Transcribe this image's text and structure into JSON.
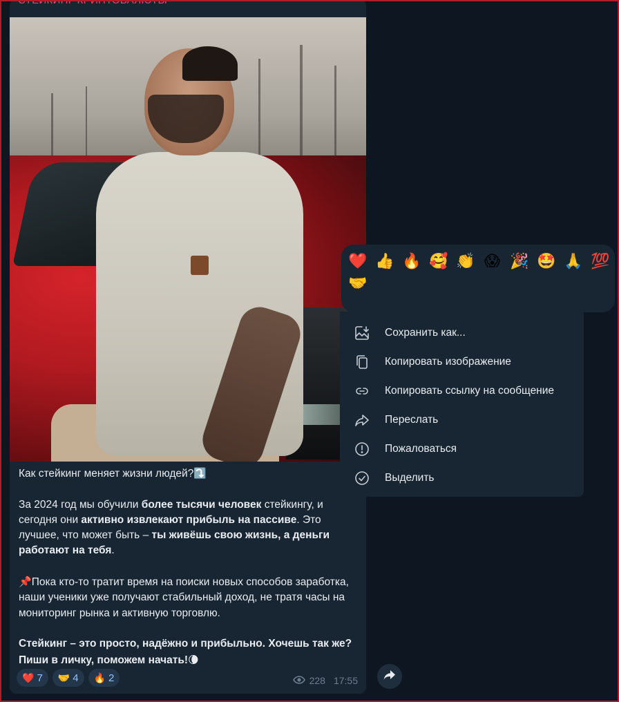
{
  "channel": {
    "name": "СТЕЙКИНГ КРИПТОВАЛЮТЫ"
  },
  "message": {
    "photo_alt": "photo",
    "title_line": "Как стейкинг меняет жизни людей?",
    "title_emoji": "⤵️",
    "p1_a": "За 2024 год мы обучили ",
    "p1_b": "более тысячи человек",
    "p1_c": " стейкингу, и сегодня они ",
    "p1_d": "активно извлекают прибыль на пассиве",
    "p1_e": ". Это лучшее, что может быть – ",
    "p1_f": "ты живёшь свою жизнь, а деньги работают на тебя",
    "p1_g": ".",
    "p2_emoji": "📌",
    "p2": "Пока кто-то тратит время на поиски новых способов заработка, наши ученики уже получают стабильный доход, не тратя часы на мониторинг рынка и активную торговлю.",
    "p3": "Стейкинг – это просто, надёжно и прибыльно. Хочешь так же? Пиши в личку, поможем начать!",
    "p3_emoji": "🌘",
    "reactions": [
      {
        "emoji": "❤️",
        "count": "7"
      },
      {
        "emoji": "🤝",
        "count": "4"
      },
      {
        "emoji": "🔥",
        "count": "2"
      }
    ],
    "views": "228",
    "time": "17:55"
  },
  "reaction_picker": {
    "row1": [
      "❤️",
      "👍",
      "🔥",
      "🥰",
      "👏",
      "😱",
      "🎉",
      "🤩",
      "🙏",
      "💯"
    ],
    "row2": [
      "🤝"
    ]
  },
  "context_menu": {
    "items": [
      {
        "icon": "save-image-icon",
        "label": "Сохранить как..."
      },
      {
        "icon": "copy-icon",
        "label": "Копировать изображение"
      },
      {
        "icon": "link-icon",
        "label": "Копировать ссылку на сообщение"
      },
      {
        "icon": "forward-icon",
        "label": "Переслать"
      },
      {
        "icon": "report-icon",
        "label": "Пожаловаться"
      },
      {
        "icon": "select-icon",
        "label": "Выделить"
      }
    ]
  },
  "colors": {
    "background": "#0e1621",
    "bubble": "#182533",
    "accent": "#8cc3ff",
    "channel_name": "#e84a6e",
    "window_border": "#b01c2a"
  }
}
